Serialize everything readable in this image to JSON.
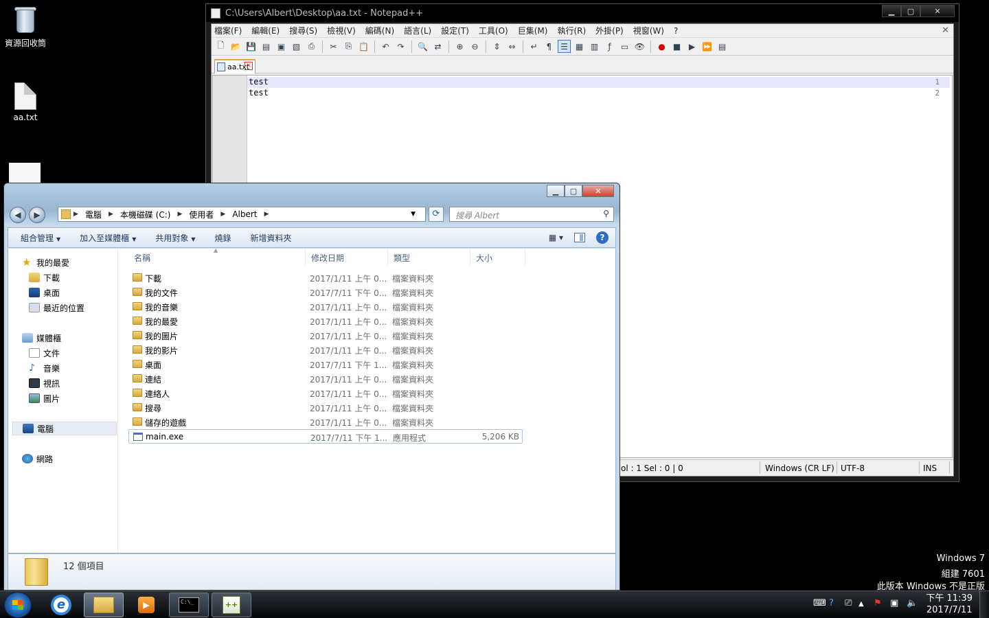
{
  "desktop": {
    "icons": [
      {
        "label": "資源回收筒"
      },
      {
        "label": "aa.txt"
      }
    ]
  },
  "notepad": {
    "title": "C:\\Users\\Albert\\Desktop\\aa.txt - Notepad++",
    "menu": [
      "檔案(F)",
      "編輯(E)",
      "搜尋(S)",
      "檢視(V)",
      "編碼(N)",
      "語言(L)",
      "設定(T)",
      "工具(O)",
      "巨集(M)",
      "執行(R)",
      "外掛(P)",
      "視窗(W)",
      "?"
    ],
    "tab_label": "aa.txt",
    "lines": [
      {
        "num": "1",
        "text": "test"
      },
      {
        "num": "2",
        "text": "test"
      }
    ],
    "status": {
      "position": "ol : 1    Sel : 0 | 0",
      "eol": "Windows (CR LF)",
      "encoding": "UTF-8",
      "mode": "INS"
    }
  },
  "explorer": {
    "breadcrumb": [
      "電腦",
      "本機磁碟 (C:)",
      "使用者",
      "Albert"
    ],
    "search_placeholder": "搜尋 Albert",
    "commands": [
      "組合管理",
      "加入至媒體櫃",
      "共用對象",
      "燒錄",
      "新增資料夾"
    ],
    "nav": {
      "favorites": "我的最愛",
      "downloads": "下載",
      "desktop": "桌面",
      "recent": "最近的位置",
      "libraries": "媒體櫃",
      "documents": "文件",
      "music": "音樂",
      "videos": "視訊",
      "pictures": "圖片",
      "computer": "電腦",
      "network": "網路"
    },
    "columns": {
      "name": "名稱",
      "date": "修改日期",
      "type": "類型",
      "size": "大小"
    },
    "files": [
      {
        "name": "下載",
        "date": "2017/1/11 上午 0...",
        "type": "檔案資料夾",
        "size": ""
      },
      {
        "name": "我的文件",
        "date": "2017/7/11 下午 0...",
        "type": "檔案資料夾",
        "size": ""
      },
      {
        "name": "我的音樂",
        "date": "2017/1/11 上午 0...",
        "type": "檔案資料夾",
        "size": ""
      },
      {
        "name": "我的最愛",
        "date": "2017/1/11 上午 0...",
        "type": "檔案資料夾",
        "size": ""
      },
      {
        "name": "我的圖片",
        "date": "2017/1/11 上午 0...",
        "type": "檔案資料夾",
        "size": ""
      },
      {
        "name": "我的影片",
        "date": "2017/1/11 上午 0...",
        "type": "檔案資料夾",
        "size": ""
      },
      {
        "name": "桌面",
        "date": "2017/7/11 下午 1...",
        "type": "檔案資料夾",
        "size": ""
      },
      {
        "name": "連結",
        "date": "2017/1/11 上午 0...",
        "type": "檔案資料夾",
        "size": ""
      },
      {
        "name": "連絡人",
        "date": "2017/1/11 上午 0...",
        "type": "檔案資料夾",
        "size": ""
      },
      {
        "name": "搜尋",
        "date": "2017/1/11 上午 0...",
        "type": "檔案資料夾",
        "size": ""
      },
      {
        "name": "儲存的遊戲",
        "date": "2017/1/11 上午 0...",
        "type": "檔案資料夾",
        "size": ""
      },
      {
        "name": "main.exe",
        "date": "2017/7/11 下午 1...",
        "type": "應用程式",
        "size": "5,206 KB"
      }
    ],
    "item_count": "12 個項目"
  },
  "watermark": {
    "line1": "Windows 7",
    "line2": "組建 7601",
    "line3": "此版本 Windows 不是正版"
  },
  "taskbar": {
    "time": "下午 11:39",
    "date": "2017/7/11"
  }
}
